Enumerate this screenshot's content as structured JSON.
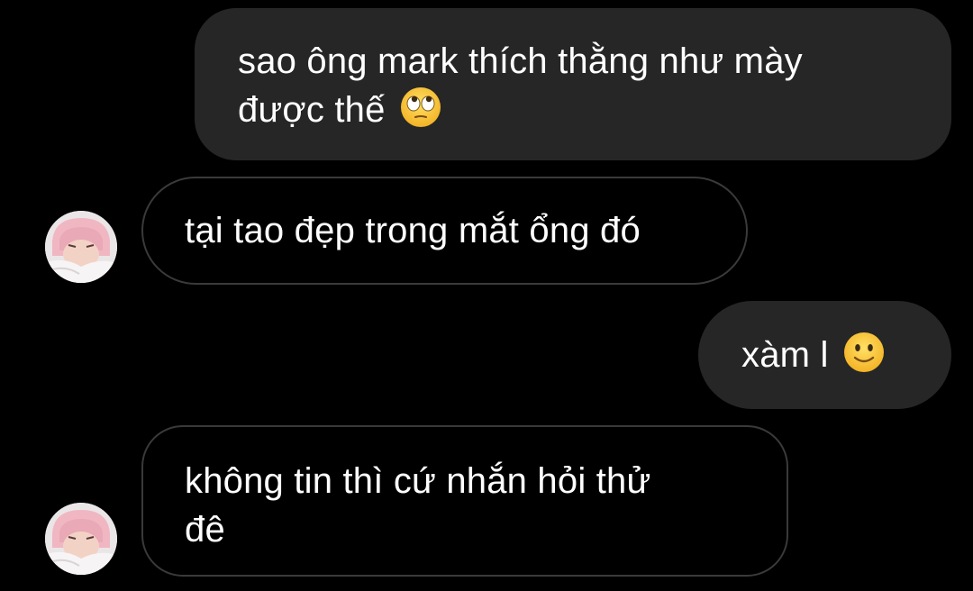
{
  "messages": [
    {
      "id": "m1",
      "side": "sent",
      "line1": "sao ông mark thích thằng như mày",
      "line2": "được thế",
      "emoji": "face-with-rolling-eyes-icon"
    },
    {
      "id": "m2",
      "side": "received",
      "text": "tại tao đẹp trong mắt ổng đó"
    },
    {
      "id": "m3",
      "side": "sent",
      "text": "xàm l",
      "emoji": "slightly-smiling-face-icon"
    },
    {
      "id": "m4",
      "side": "received",
      "line1": "không tin thì cứ nhắn hỏi thử",
      "line2": "đê"
    }
  ],
  "colors": {
    "background": "#000000",
    "sent_bubble": "#262626",
    "received_border": "#3a3a3a",
    "text": "#ffffff",
    "emoji_yellow": "#f7c431"
  }
}
